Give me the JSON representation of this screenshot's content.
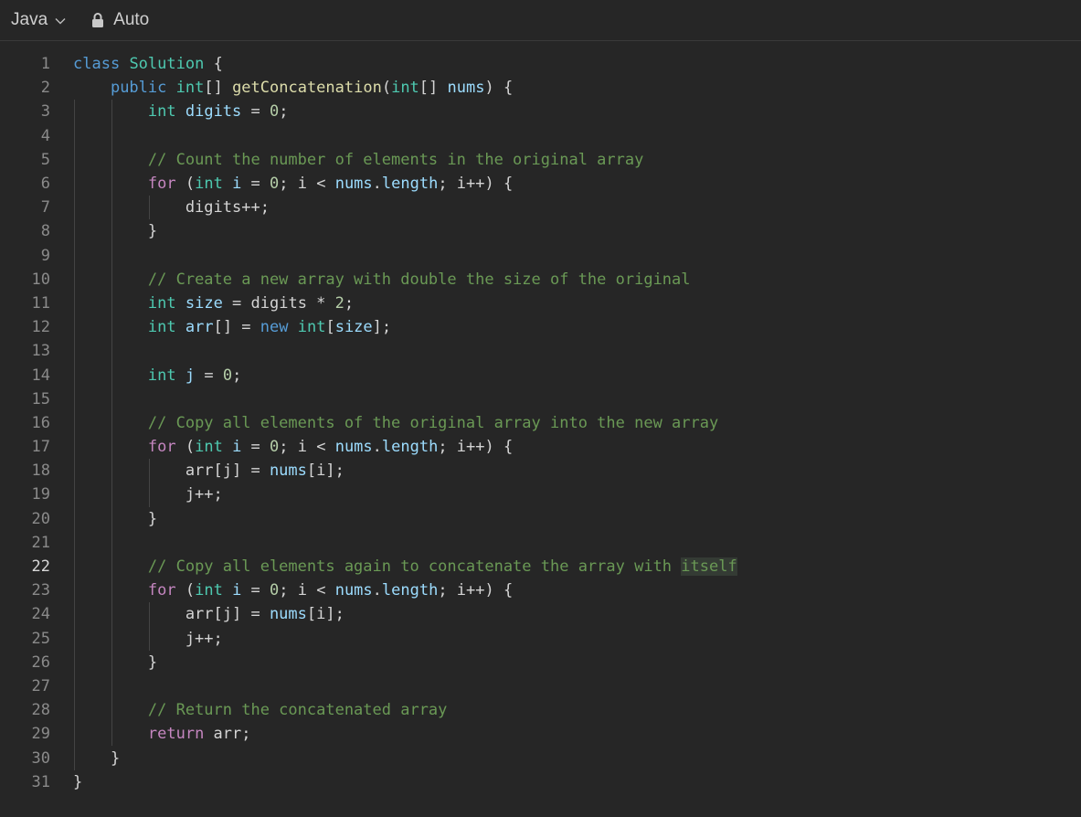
{
  "toolbar": {
    "language": "Java",
    "mode": "Auto",
    "language_icon": "chevron-down-icon",
    "mode_icon": "lock-icon"
  },
  "editor": {
    "active_line": 22,
    "colors": {
      "background": "#262626",
      "keyword": "#569cd6",
      "control": "#c586c0",
      "type": "#4ec9b0",
      "function": "#dcdcaa",
      "variable": "#9cdcfe",
      "number": "#b5cea8",
      "comment": "#6a9955"
    },
    "lines": [
      {
        "n": "1",
        "text": "class Solution {"
      },
      {
        "n": "2",
        "text": "    public int[] getConcatenation(int[] nums) {"
      },
      {
        "n": "3",
        "text": "        int digits = 0;"
      },
      {
        "n": "4",
        "text": ""
      },
      {
        "n": "5",
        "text": "        // Count the number of elements in the original array"
      },
      {
        "n": "6",
        "text": "        for (int i = 0; i < nums.length; i++) {"
      },
      {
        "n": "7",
        "text": "            digits++;"
      },
      {
        "n": "8",
        "text": "        }"
      },
      {
        "n": "9",
        "text": ""
      },
      {
        "n": "10",
        "text": "        // Create a new array with double the size of the original"
      },
      {
        "n": "11",
        "text": "        int size = digits * 2;"
      },
      {
        "n": "12",
        "text": "        int arr[] = new int[size];"
      },
      {
        "n": "13",
        "text": ""
      },
      {
        "n": "14",
        "text": "        int j = 0;"
      },
      {
        "n": "15",
        "text": ""
      },
      {
        "n": "16",
        "text": "        // Copy all elements of the original array into the new array"
      },
      {
        "n": "17",
        "text": "        for (int i = 0; i < nums.length; i++) {"
      },
      {
        "n": "18",
        "text": "            arr[j] = nums[i];"
      },
      {
        "n": "19",
        "text": "            j++;"
      },
      {
        "n": "20",
        "text": "        }"
      },
      {
        "n": "21",
        "text": ""
      },
      {
        "n": "22",
        "text": "        // Copy all elements again to concatenate the array with itself"
      },
      {
        "n": "23",
        "text": "        for (int i = 0; i < nums.length; i++) {"
      },
      {
        "n": "24",
        "text": "            arr[j] = nums[i];"
      },
      {
        "n": "25",
        "text": "            j++;"
      },
      {
        "n": "26",
        "text": "        }"
      },
      {
        "n": "27",
        "text": ""
      },
      {
        "n": "28",
        "text": "        // Return the concatenated array"
      },
      {
        "n": "29",
        "text": "        return arr;"
      },
      {
        "n": "30",
        "text": "    }"
      },
      {
        "n": "31",
        "text": "}"
      }
    ]
  }
}
